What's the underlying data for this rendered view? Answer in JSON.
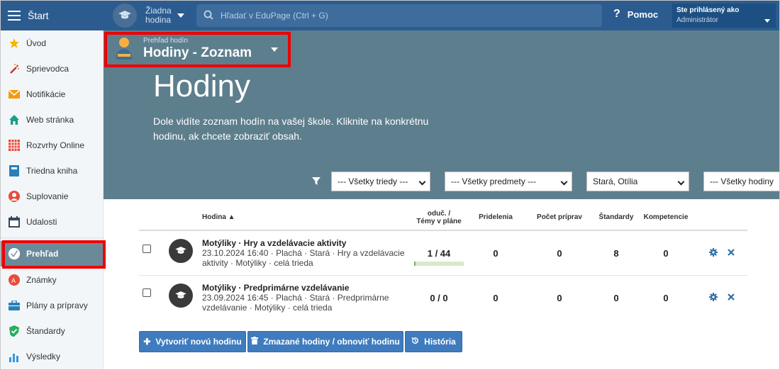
{
  "topbar": {
    "start_label": "Štart",
    "lesson_line1": "Žiadna",
    "lesson_line2": "hodina",
    "search_placeholder": "Hľadať v EduPage (Ctrl + G)",
    "help_label": "Pomoc",
    "user_line1": "Ste prihlásený ako",
    "user_line2": "Administrátor"
  },
  "sidebar": {
    "items": [
      {
        "label": "Úvod",
        "icon": "star-icon"
      },
      {
        "label": "Sprievodca",
        "icon": "magic-wand-icon"
      },
      {
        "label": "Notifikácie",
        "icon": "envelope-icon"
      },
      {
        "label": "Web stránka",
        "icon": "house-icon"
      },
      {
        "label": "Rozvrhy Online",
        "icon": "timetable-icon"
      },
      {
        "label": "Triedna kniha",
        "icon": "book-icon"
      },
      {
        "label": "Suplovanie",
        "icon": "substitute-icon"
      },
      {
        "label": "Udalosti",
        "icon": "calendar-icon"
      },
      {
        "label": "Prehľad",
        "icon": "check-circle-icon"
      },
      {
        "label": "Známky",
        "icon": "grades-icon"
      },
      {
        "label": "Plány a prípravy",
        "icon": "briefcase-icon"
      },
      {
        "label": "Štandardy",
        "icon": "shield-check-icon"
      },
      {
        "label": "Výsledky",
        "icon": "bar-chart-icon"
      }
    ]
  },
  "header": {
    "crumb_small": "Prehľad hodín",
    "crumb_big": "Hodiny - Zoznam",
    "title": "Hodiny",
    "description": "Dole vidíte zoznam hodín na vašej škole. Kliknite na konkrétnu hodinu, ak chcete zobraziť obsah."
  },
  "filters": {
    "classes": "--- Všetky triedy ---",
    "subjects": "--- Všetky predmety ---",
    "teacher": "Stará, Otília",
    "lessons": "--- Všetky hodiny"
  },
  "table": {
    "col_lesson": "Hodina ▲",
    "col_taught_1": "oduč. /",
    "col_taught_2": "Témy v pláne",
    "col_assign": "Pridelenia",
    "col_preps": "Počet príprav",
    "col_standards": "Štandardy",
    "col_competences": "Kompetencie",
    "rows": [
      {
        "title": "Motýliky · Hry a vzdelávacie aktivity",
        "sub1": "23.10.2024 16:40 · Plachá · Stará · Hry a vzdelávacie",
        "sub2": "aktivity · Motýliky · celá trieda",
        "taught": "1 / 44",
        "taught_progress": 0.023,
        "assign": "0",
        "preps": "0",
        "standards": "8",
        "competences": "0"
      },
      {
        "title": "Motýliky · Predprimárne vzdelávanie",
        "sub1": "23.09.2024 16:45 · Plachá · Stará · Predprimárne",
        "sub2": "vzdelávanie · Motýliky · celá trieda",
        "taught": "0 / 0",
        "assign": "0",
        "preps": "0",
        "standards": "0",
        "competences": "0"
      }
    ]
  },
  "buttons": {
    "new_lesson": "Vytvoriť novú hodinu",
    "deleted_lessons": "Zmazané hodiny / obnoviť hodinu",
    "history": "História"
  },
  "colors": {
    "topbar": "#2c5c8f",
    "hero": "#5d7e8d",
    "button": "#3f7cbf",
    "highlight": "#ee0000"
  }
}
